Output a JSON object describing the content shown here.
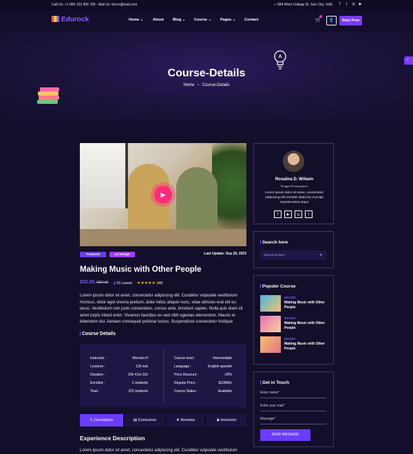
{
  "topbar": {
    "contact": "Call Us: +1 800 123 456 789 - Mail Us: ltcroc@mail.com",
    "address": "684 West College St. Sun City, USA",
    "social": [
      "f",
      "t",
      "◎",
      "▶"
    ]
  },
  "header": {
    "logo": "Edurock",
    "nav": [
      "Home",
      "About",
      "Blog",
      "Course",
      "Pages",
      "Contact"
    ],
    "start_button": "Start Free"
  },
  "hero": {
    "title": "Course-Details",
    "crumb_home": "Home",
    "crumb_sep": "›",
    "crumb_current": "Course-Details"
  },
  "course": {
    "badge_featured": "Featured",
    "badge_category": "Ux Design",
    "last_update": "Last Update: Sep 29, 2023",
    "title": "Making Music with Other People",
    "price": "$32.00",
    "old_price": "/ $67.00",
    "lessons": "23 Lesson",
    "stars": "★★★★★",
    "rating_count": "(44)",
    "description": "Lorem ipsum dolor sit amet, consectetur adipiscing elit. Curabitur vulputate vestibulum rhoncus, dolor eget viverra pretium, dolor tellus aliquet nunc, vitae ultricies erat elit eu lacus. Vestibulum non justo consectetur, cursus ante, tincidunt sapien. Nulla quis diam sit amet turpis interd enim. Vivamus faucibus ex sed nibh egestas elementum. Mauris et bibendum dui. Aenean consequat pulvinar luctus. Suspendisse consectetur tristique",
    "details_heading": "Course Details",
    "details_left": [
      {
        "k": "Instructor :",
        "v": "Mirnsdo.H"
      },
      {
        "k": "Lectures :",
        "v": "120 sub"
      },
      {
        "k": "Duration :",
        "v": "20h 41m 32s"
      },
      {
        "k": "Enrolled :",
        "v": "2 students"
      },
      {
        "k": "Total :",
        "v": "222 students"
      }
    ],
    "details_right": [
      {
        "k": "Course level :",
        "v": "Intermediate"
      },
      {
        "k": "Language :",
        "v": "English spanish"
      },
      {
        "k": "Price Discount :",
        "v": "-20%"
      },
      {
        "k": "Regular Price :",
        "v": "$228/Mo"
      },
      {
        "k": "Course Status :",
        "v": "Available"
      }
    ],
    "tabs": [
      "Description",
      "Curriculum",
      "Reviews",
      "Instructor"
    ],
    "tab_icons": [
      "✎",
      "▤",
      "★",
      "♟"
    ],
    "experience_heading": "Experience Description",
    "experience_text": "Lorem ipsum dolor sit amet, consectetur adipiscing elit. Curabitur vulputate vestibulum"
  },
  "sidebar": {
    "profile": {
      "name": "Rosalina D. Willaim",
      "role": "Blogger/Photographer",
      "bio": "Lorem ipsum dolor sit amet, consectetur adipiscing elit.Veritatis distinctio suscipit reprehenderit atque",
      "social": [
        "f",
        "▶",
        "◎",
        "t"
      ]
    },
    "search": {
      "heading": "Search here",
      "placeholder": "Search product"
    },
    "popular": {
      "heading": "Populer Course",
      "items": [
        {
          "price": "$32,000",
          "title": "Making Music with Other People",
          "color": "#4bb6e3"
        },
        {
          "price": "$32,000",
          "title": "Making Music with Other People",
          "color": "#e86fb4"
        },
        {
          "price": "$32,000",
          "title": "Making Music with Other People",
          "color": "#f2c46a"
        }
      ]
    },
    "contact": {
      "heading": "Get in Touch",
      "name_placeholder": "Enter name*",
      "mail_placeholder": "Enter your mail*",
      "message_placeholder": "Massage*",
      "button": "SEND MASSAGE"
    }
  },
  "colors": {
    "accent": "#7a3cff",
    "background": "#130f2b",
    "play": "#ff2c78"
  }
}
